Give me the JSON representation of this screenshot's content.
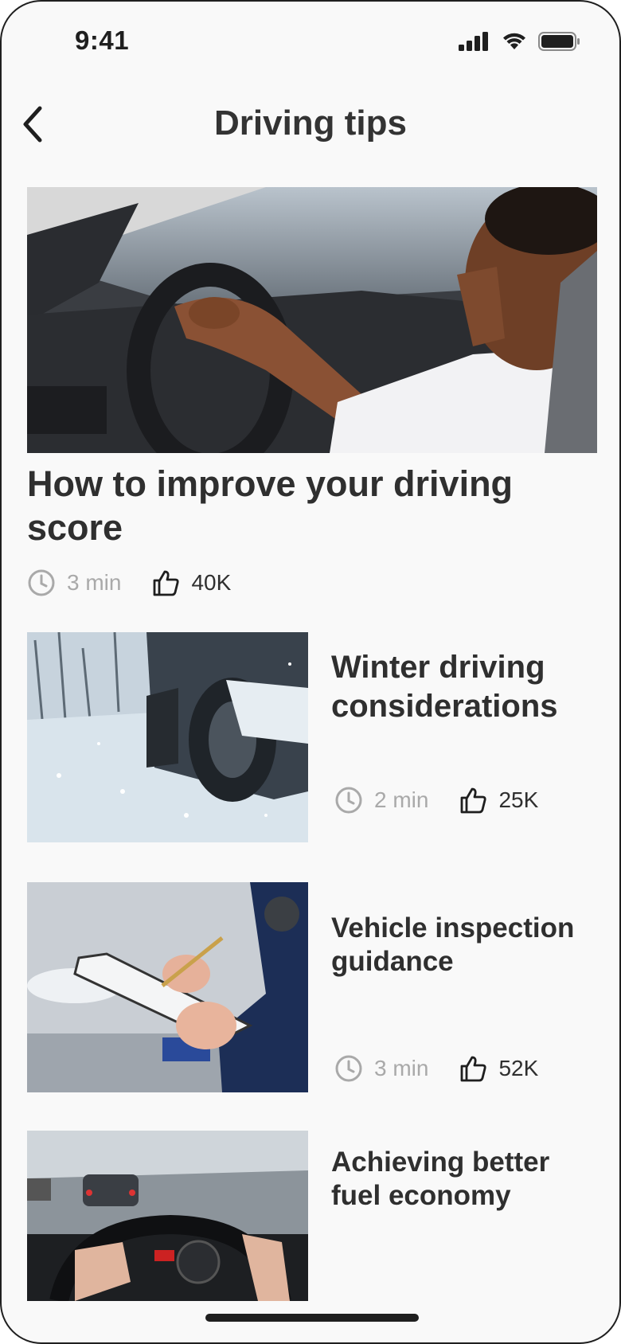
{
  "status_bar": {
    "time": "9:41"
  },
  "header": {
    "title": "Driving tips"
  },
  "featured": {
    "title": "How to improve your driving score",
    "duration": "3 min",
    "likes": "40K"
  },
  "articles": [
    {
      "title": "Winter driving considerations",
      "duration": "2 min",
      "likes": "25K"
    },
    {
      "title": "Vehicle inspection guidance",
      "duration": "3 min",
      "likes": "52K"
    },
    {
      "title": "Achieving better fuel economy"
    }
  ],
  "icons": {
    "back": "chevron-left-icon",
    "duration": "clock-icon",
    "likes": "thumbs-up-icon",
    "signal": "cellular-signal-icon",
    "wifi": "wifi-icon",
    "battery": "battery-icon"
  }
}
